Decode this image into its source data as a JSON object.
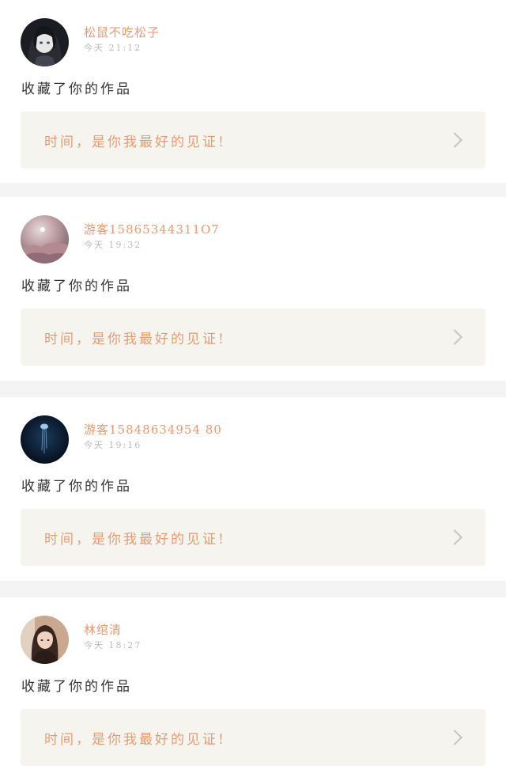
{
  "notifications": [
    {
      "username": "松鼠不吃松子",
      "time": "今天 21:12",
      "action": "收藏了你的作品",
      "quote": "时间，是你我最好的见证!",
      "avatar": "avatar-dark-hair-girl"
    },
    {
      "username": "游客15865344311O7",
      "time": "今天 19:32",
      "action": "收藏了你的作品",
      "quote": "时间，是你我最好的见证!",
      "avatar": "avatar-pink-sky"
    },
    {
      "username": "游客15848634954 80",
      "time": "今天 19:16",
      "action": "收藏了你的作品",
      "quote": "时间，是你我最好的见证!",
      "avatar": "avatar-jellyfish"
    },
    {
      "username": "林绾清",
      "time": "今天 18:27",
      "action": "收藏了你的作品",
      "quote": "时间，是你我最好的见证!",
      "avatar": "avatar-woman-portrait"
    }
  ],
  "colors": {
    "accent": "#e89a72",
    "quote_bg": "#f5f4ef",
    "divider": "#f4f4f4"
  }
}
